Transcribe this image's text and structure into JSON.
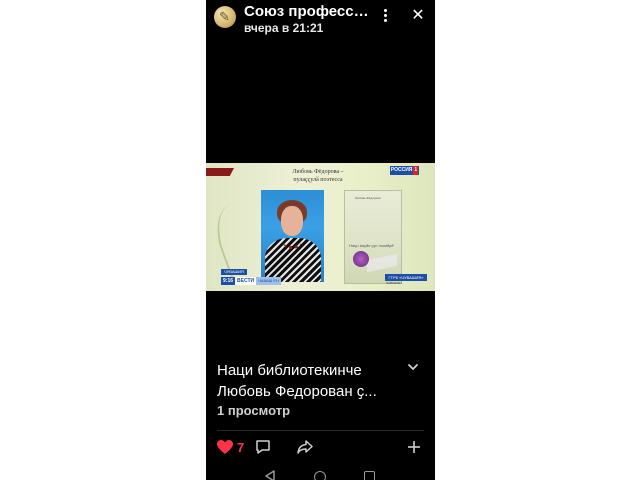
{
  "header": {
    "channel_title": "Союз профессиональных литераторов",
    "time": "вчера в 21:21"
  },
  "video": {
    "slide_title_line1": "Любовь Фёдорова –",
    "slide_title_line2": "пулаҫҫулӑ поэтесса",
    "book_author": "Любовь Фёдорова",
    "book_title": "Наци ваҫӑн ҫус тимӗрӗ",
    "channel_logo": "РОССИЯ",
    "channel_logo_num": "1",
    "region_tag": "ЧУВАШИЯ",
    "clock": "9:16",
    "vesti": "ВЕСТИ",
    "vesti_sub": "ЧАВАШ ЕН",
    "gtrk": "ГТРК «ЧУВАШИЯ»",
    "gtrk_sub": "ЧАВАШ ЕН"
  },
  "post": {
    "caption_line1": "Наци библиотекинче",
    "caption_line2": "Любовь Федорован ҫ...",
    "views": "1 просмотр",
    "likes": "7"
  },
  "colors": {
    "background": "#000000",
    "like": "#ff3347",
    "accent_blue": "#1d4fa6"
  },
  "icons": [
    "more-icon",
    "close-icon",
    "chevron-down-icon",
    "heart-icon",
    "comment-icon",
    "share-icon",
    "plus-icon",
    "nav-back-icon",
    "nav-home-icon",
    "nav-recent-icon"
  ]
}
